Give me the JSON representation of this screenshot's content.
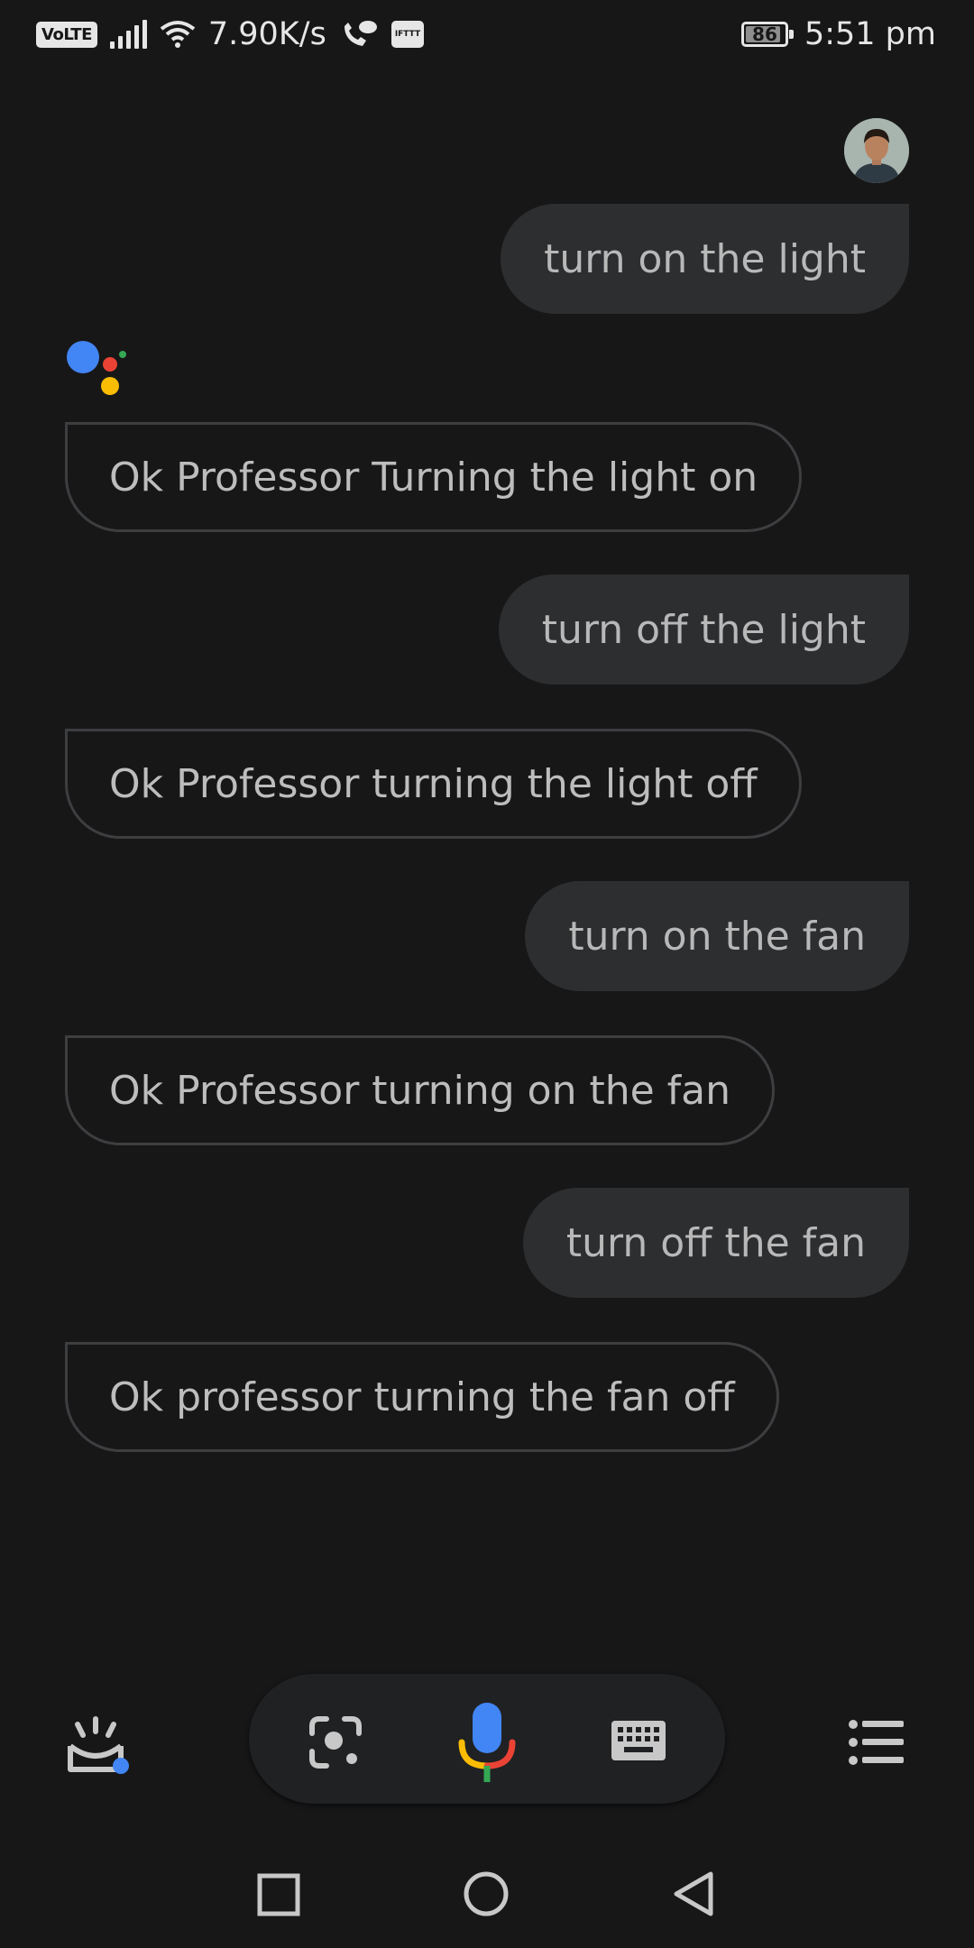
{
  "status_bar": {
    "volte": "VoLTE",
    "net_speed": "7.90K/s",
    "ifttt": "IFTTT",
    "battery": "86",
    "time": "5:51 pm"
  },
  "messages": [
    {
      "role": "user",
      "text": "turn on the light"
    },
    {
      "role": "assistant",
      "text": "Ok Professor Turning the light on"
    },
    {
      "role": "user",
      "text": "turn off the light"
    },
    {
      "role": "assistant",
      "text": "Ok Professor turning the light off"
    },
    {
      "role": "user",
      "text": "turn on the fan"
    },
    {
      "role": "assistant",
      "text": "Ok Professor turning on the fan"
    },
    {
      "role": "user",
      "text": "turn off the fan"
    },
    {
      "role": "assistant",
      "text": "Ok professor turning the fan off"
    }
  ],
  "colors": {
    "background": "#171718",
    "user_bubble": "#2d2e30",
    "google_blue": "#4285f4",
    "google_red": "#ea4335",
    "google_yellow": "#fbbc04",
    "google_green": "#34a853"
  },
  "icons": {
    "explore": "explore-snapshot-icon",
    "lens": "lens-icon",
    "mic": "microphone-icon",
    "keyboard": "keyboard-icon",
    "list": "list-icon",
    "nav": [
      "recents-square-icon",
      "home-circle-icon",
      "back-triangle-icon"
    ]
  }
}
